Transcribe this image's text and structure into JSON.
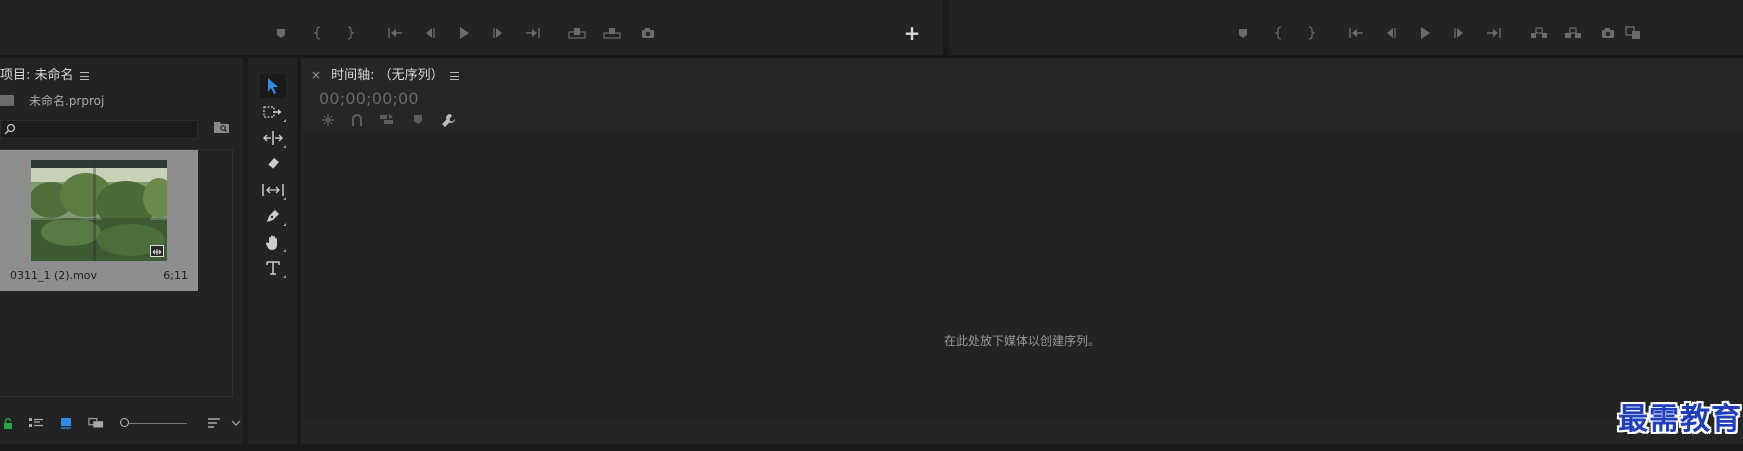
{
  "colors": {
    "panel_bg": "#232323",
    "app_bg": "#1a1a1a",
    "accent_blue": "#2d8ceb",
    "lock_green": "#27a74a",
    "watermark_blue": "#1f3fbf"
  },
  "source_monitor": {
    "controls": [
      "add-marker-icon",
      "mark-in-icon",
      "mark-out-icon",
      "go-to-in-icon",
      "step-back-icon",
      "play-icon",
      "step-forward-icon",
      "go-to-out-icon",
      "insert-icon",
      "overwrite-icon",
      "export-frame-icon"
    ],
    "button_editor_label": "+"
  },
  "program_monitor": {
    "controls": [
      "add-marker-icon",
      "mark-in-icon",
      "mark-out-icon",
      "go-to-in-icon",
      "step-back-icon",
      "play-icon",
      "step-forward-icon",
      "go-to-out-icon",
      "lift-icon",
      "extract-icon",
      "export-frame-icon",
      "comparison-view-icon"
    ]
  },
  "project": {
    "title": "项目: 未命名",
    "file_name": "未命名.prproj",
    "search_placeholder": "",
    "clip": {
      "name": "0311_1 (2).mov",
      "duration": "6;11"
    },
    "bottom_icons": [
      "lock-icon",
      "list-view-icon",
      "icon-view-icon",
      "freeform-view-icon",
      "zoom-slider",
      "sort-icon",
      "chevron-down-icon"
    ]
  },
  "tools": [
    "selection-tool",
    "track-select-tool",
    "ripple-edit-tool",
    "razor-tool",
    "slip-tool",
    "pen-tool",
    "hand-tool",
    "type-tool"
  ],
  "timeline": {
    "tab_close": "×",
    "tab_title": "时间轴: （无序列）",
    "timecode": "00;00;00;00",
    "tool_icons": [
      "snap-icon",
      "linked-selection-icon",
      "nest-icon",
      "add-marker-icon",
      "wrench-icon"
    ],
    "empty_message": "在此处放下媒体以创建序列。"
  },
  "watermark": "最需教育"
}
